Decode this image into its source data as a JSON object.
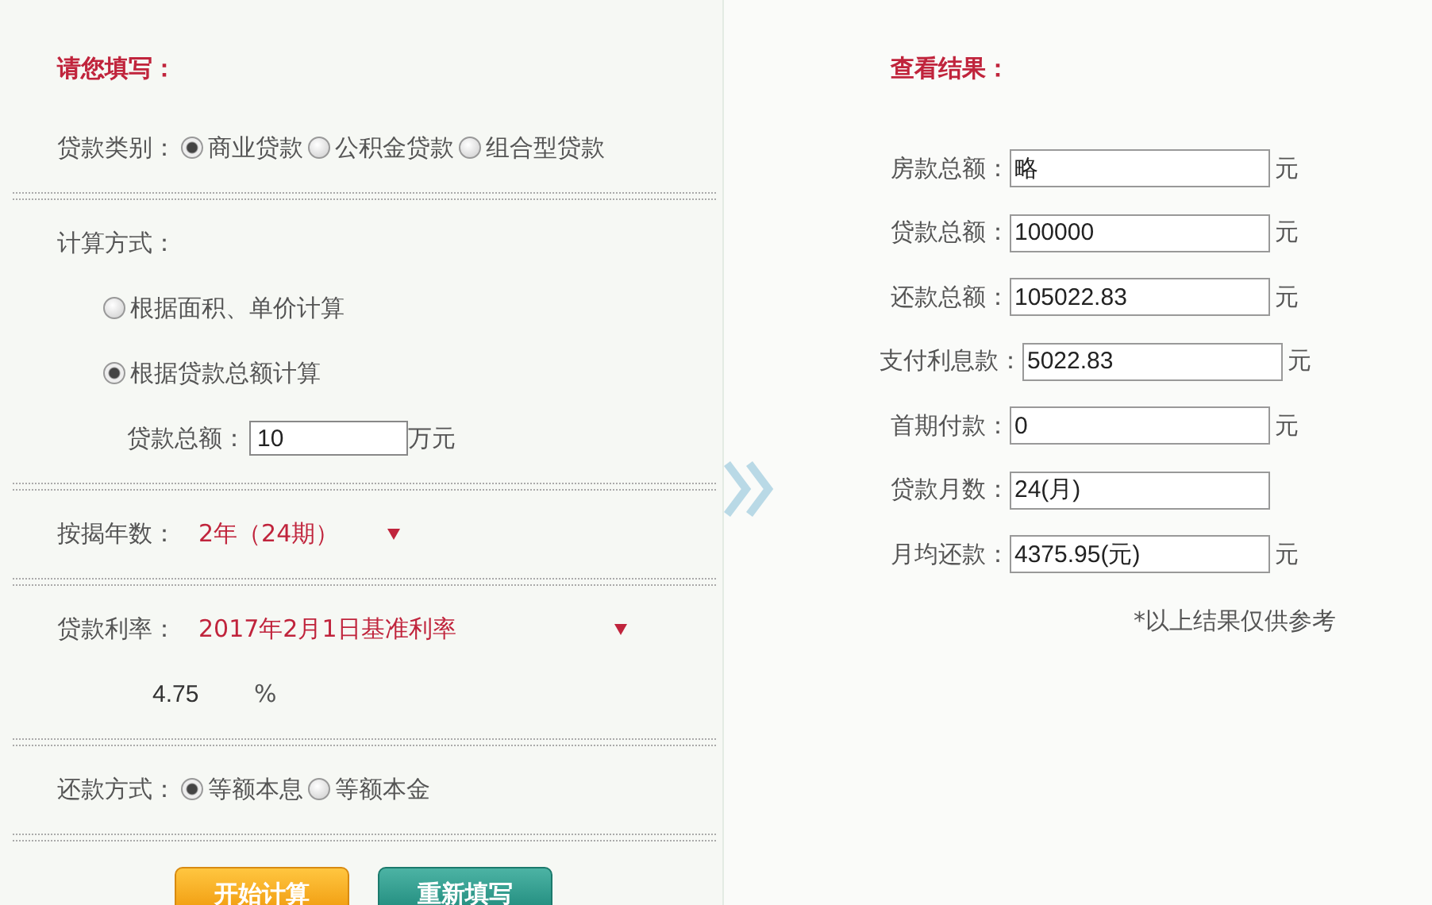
{
  "form": {
    "title": "请您填写：",
    "loan_type": {
      "label": "贷款类别：",
      "options": [
        {
          "label": "商业贷款",
          "selected": true
        },
        {
          "label": "公积金贷款",
          "selected": false
        },
        {
          "label": "组合型贷款",
          "selected": false
        }
      ]
    },
    "calc_method": {
      "label": "计算方式：",
      "options": [
        {
          "label": "根据面积、单价计算",
          "selected": false
        },
        {
          "label": "根据贷款总额计算",
          "selected": true
        }
      ]
    },
    "loan_amount": {
      "label": "贷款总额：",
      "value": "10",
      "unit": "万元"
    },
    "term": {
      "label": "按揭年数：",
      "value": "2年（24期）"
    },
    "rate": {
      "label": "贷款利率：",
      "value": "2017年2月1日基准利率",
      "rate_value": "4.75",
      "unit": "%"
    },
    "repayment": {
      "label": "还款方式：",
      "options": [
        {
          "label": "等额本息",
          "selected": true
        },
        {
          "label": "等额本金",
          "selected": false
        }
      ]
    },
    "buttons": [
      {
        "label": "开始计算",
        "kind": "primary"
      },
      {
        "label": "重新填写",
        "kind": "secondary"
      }
    ]
  },
  "results": {
    "title": "查看结果：",
    "rows": [
      {
        "label": "房款总额：",
        "value": "略",
        "unit": "元"
      },
      {
        "label": "贷款总额：",
        "value": "100000",
        "unit": "元"
      },
      {
        "label": "还款总额：",
        "value": "105022.83",
        "unit": "元"
      },
      {
        "label": "支付利息款：",
        "value": "5022.83",
        "unit": "元"
      },
      {
        "label": "首期付款：",
        "value": "0",
        "unit": "元"
      },
      {
        "label": "贷款月数：",
        "value": "24(月)"
      },
      {
        "label": "月均还款：",
        "value": "4375.95(元)",
        "unit": "元"
      }
    ],
    "note": "*以上结果仅供参考"
  }
}
